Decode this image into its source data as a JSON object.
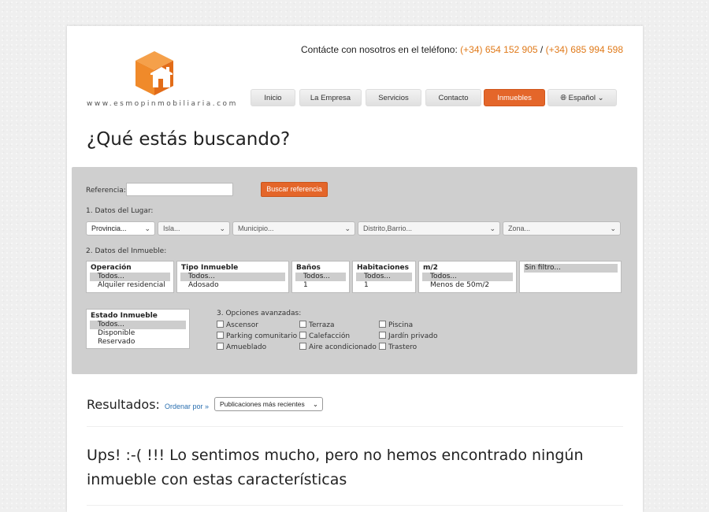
{
  "header": {
    "contact_text": "Contácte con nosotros en el teléfono: ",
    "phone1": "(+34) 654 152 905",
    "separator": " / ",
    "phone2": "(+34) 685 994 598",
    "logo_text": "www.esmopinmobiliaria.com",
    "logo_icon": "house-cube-logo"
  },
  "nav": {
    "items": [
      "Inicio",
      "La Empresa",
      "Servicios",
      "Contacto",
      "Inmuebles"
    ],
    "active": "Inmuebles",
    "language": "Español"
  },
  "search": {
    "heading": "¿Qué estás buscando?",
    "referencia_label": "Referencia:",
    "referencia_value": "",
    "buscar_button": "Buscar referencia",
    "section1": "1. Datos del Lugar:",
    "location_selects": [
      "Provincia...",
      "Isla...",
      "Municipio...",
      "Distrito,Barrio...",
      "Zona..."
    ],
    "section2": "2. Datos del Inmueble:",
    "listboxes": [
      {
        "title": "Operación",
        "options": [
          "Todos...",
          "Alquiler residencial"
        ]
      },
      {
        "title": "Tipo Inmueble",
        "options": [
          "Todos...",
          "Adosado"
        ]
      },
      {
        "title": "Baños",
        "options": [
          "Todos...",
          "1"
        ]
      },
      {
        "title": "Habitaciones",
        "options": [
          "Todos...",
          "1"
        ]
      },
      {
        "title": "m/2",
        "options": [
          "Todos...",
          "Menos de 50m/2"
        ]
      }
    ],
    "price_filter": "Sin filtro...",
    "estado": {
      "title": "Estado Inmueble",
      "options": [
        "Todos...",
        "Disponible",
        "Reservado"
      ]
    },
    "section3": "3. Opciones avanzadas:",
    "advanced_options": [
      [
        "Ascensor",
        "Terraza",
        "Piscina"
      ],
      [
        "Parking comunitario",
        "Calefacción",
        "Jardín privado"
      ],
      [
        "Amueblado",
        "Aire acondicionado",
        "Trastero"
      ]
    ]
  },
  "results": {
    "label": "Resultados:",
    "order_label": "Ordenar por »",
    "order_value": "Publicaciones más recientes",
    "no_results": "Ups! :-( !!! Lo sentimos mucho, pero no hemos encontrado ningún inmueble con estas características"
  },
  "colors": {
    "accent": "#e4662a",
    "phone": "#e07a1a",
    "link": "#2a6fb0"
  }
}
